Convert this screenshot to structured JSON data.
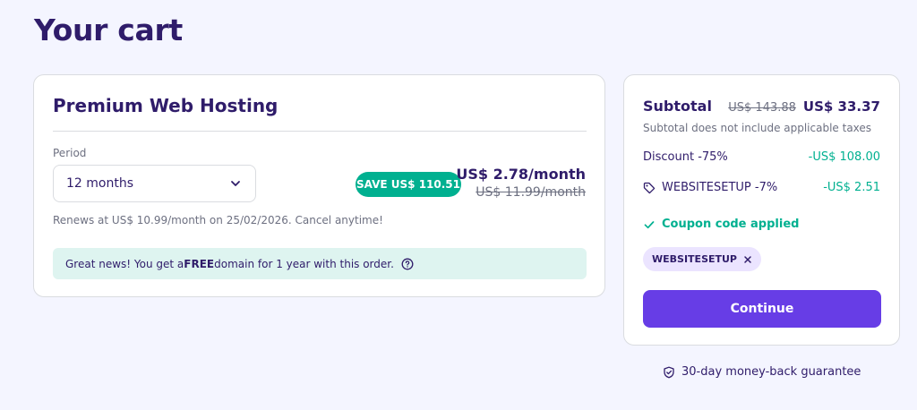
{
  "page": {
    "title": "Your cart"
  },
  "product": {
    "name": "Premium Web Hosting",
    "period_label": "Period",
    "period_value": "12 months",
    "save_badge": "SAVE US$ 110.51",
    "price_now": "US$ 2.78/month",
    "price_old": "US$ 11.99/month",
    "renew_text": "Renews at US$ 10.99/month on 25/02/2026. Cancel anytime!",
    "promo": {
      "prefix": "Great news! You get a ",
      "bold": "FREE",
      "suffix": " domain for 1 year with this order."
    }
  },
  "summary": {
    "subtotal_label": "Subtotal",
    "subtotal_old": "US$ 143.88",
    "subtotal_now": "US$ 33.37",
    "tax_note": "Subtotal does not include applicable taxes",
    "discount_label": "Discount -75%",
    "discount_value": "-US$ 108.00",
    "coupon_label": "WEBSITESETUP -7%",
    "coupon_value": "-US$ 2.51",
    "coupon_applied": "Coupon code applied",
    "coupon_chip": "WEBSITESETUP",
    "continue_label": "Continue"
  },
  "guarantee": "30-day money-back guarantee",
  "colors": {
    "brand_purple": "#673de6",
    "heading": "#2f1c6a",
    "success_green": "#00b090",
    "background": "#f4f5ff"
  },
  "icons": [
    "chevron-down-icon",
    "help-circle-icon",
    "tag-icon",
    "check-icon",
    "close-icon",
    "shield-check-icon"
  ]
}
